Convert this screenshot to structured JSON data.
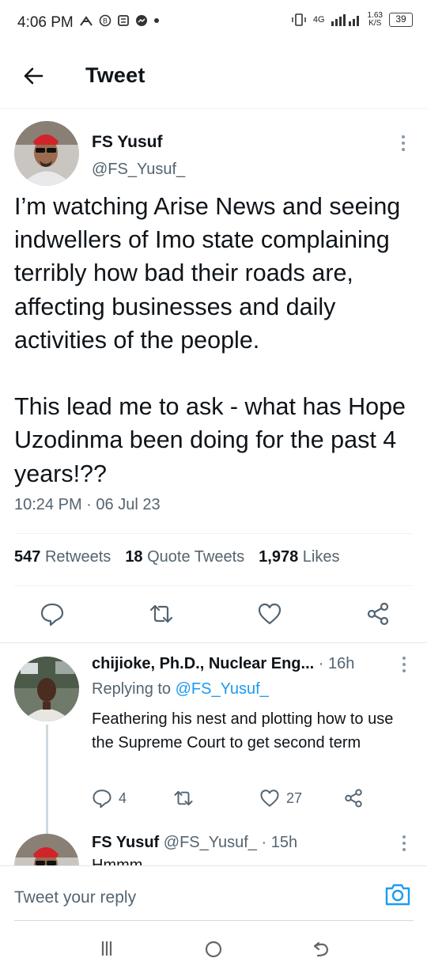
{
  "status_bar": {
    "time": "4:06 PM",
    "network": "4G",
    "speed_value": "1.63",
    "speed_unit": "K/S",
    "battery": "39"
  },
  "header": {
    "title": "Tweet"
  },
  "tweet": {
    "author_name": "FS Yusuf",
    "author_handle": "@FS_Yusuf_",
    "text": "I’m watching Arise News and seeing indwellers of Imo state complaining terribly how bad their roads are, affecting businesses and daily activities of the people.\n\nThis lead me to ask - what has Hope Uzodinma been doing for the past 4 years!??",
    "time": "10:24 PM",
    "date": "06 Jul 23",
    "retweets_count": "547",
    "retweets_label": "Retweets",
    "quotes_count": "18",
    "quotes_label": "Quote Tweets",
    "likes_count": "1,978",
    "likes_label": "Likes"
  },
  "reply": {
    "author_name": "chijioke, Ph.D., Nuclear Eng...",
    "time_ago": "16h",
    "replying_label": "Replying to",
    "replying_handle": "@FS_Yusuf_",
    "text": "Feathering his nest and plotting how to use the Supreme Court to get second term",
    "replies_count": "4",
    "likes_count": "27"
  },
  "reply2": {
    "author_name": "FS Yusuf",
    "author_handle": "@FS_Yusuf_",
    "time_ago": "15h",
    "text_partial": "Hmmm"
  },
  "composer": {
    "placeholder": "Tweet your reply"
  },
  "colors": {
    "accent": "#1d9bf0",
    "secondary_text": "#536471",
    "primary_text": "#0f1419"
  },
  "icons": {
    "back": "arrow-left-icon",
    "more": "more-vertical-icon",
    "reply": "comment-icon",
    "retweet": "retweet-icon",
    "like": "heart-icon",
    "share": "share-icon",
    "camera": "camera-icon"
  }
}
